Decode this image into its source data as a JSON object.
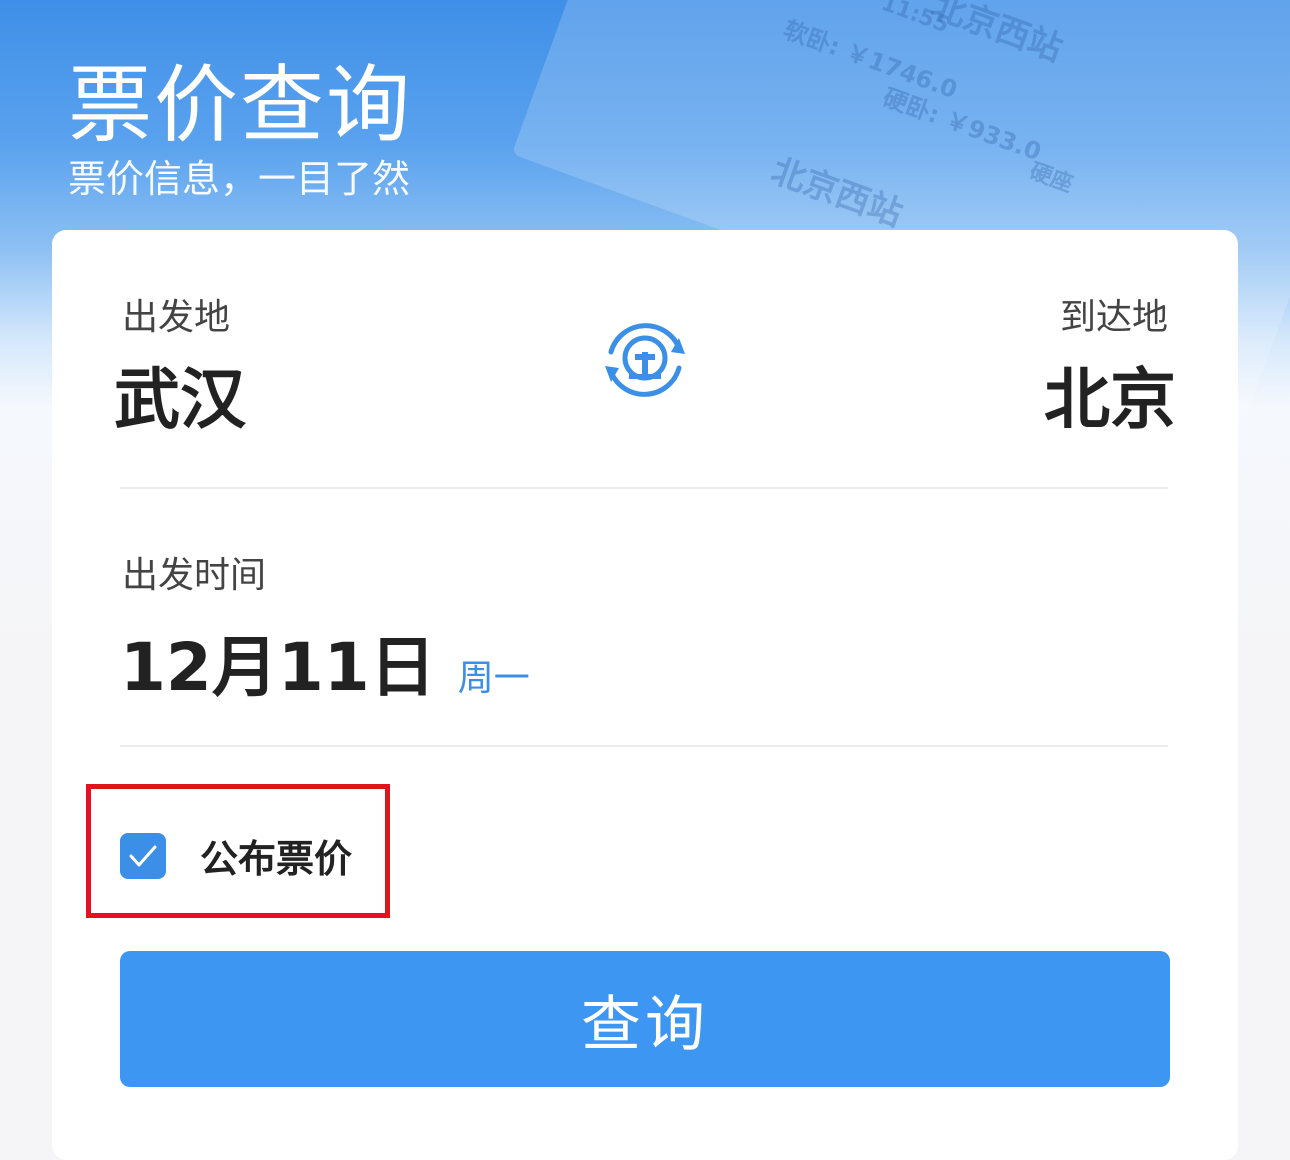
{
  "header": {
    "title": "票价查询",
    "subtitle": "票价信息，一目了然"
  },
  "decoration": {
    "ticket_texts": [
      "北京西站",
      "软卧: ￥1746.0",
      "硬卧: ￥933.0",
      "北京西站",
      "11:55",
      "硬座"
    ]
  },
  "route": {
    "from_label": "出发地",
    "from_value": "武汉",
    "to_label": "到达地",
    "to_value": "北京",
    "swap_icon": "railway-swap-icon"
  },
  "date": {
    "label": "出发时间",
    "value": "12月11日",
    "weekday": "周一"
  },
  "options": {
    "published_price_label": "公布票价",
    "published_price_checked": true
  },
  "actions": {
    "search_label": "查询"
  },
  "colors": {
    "accent": "#3d96f2",
    "highlight": "#e0141e"
  }
}
